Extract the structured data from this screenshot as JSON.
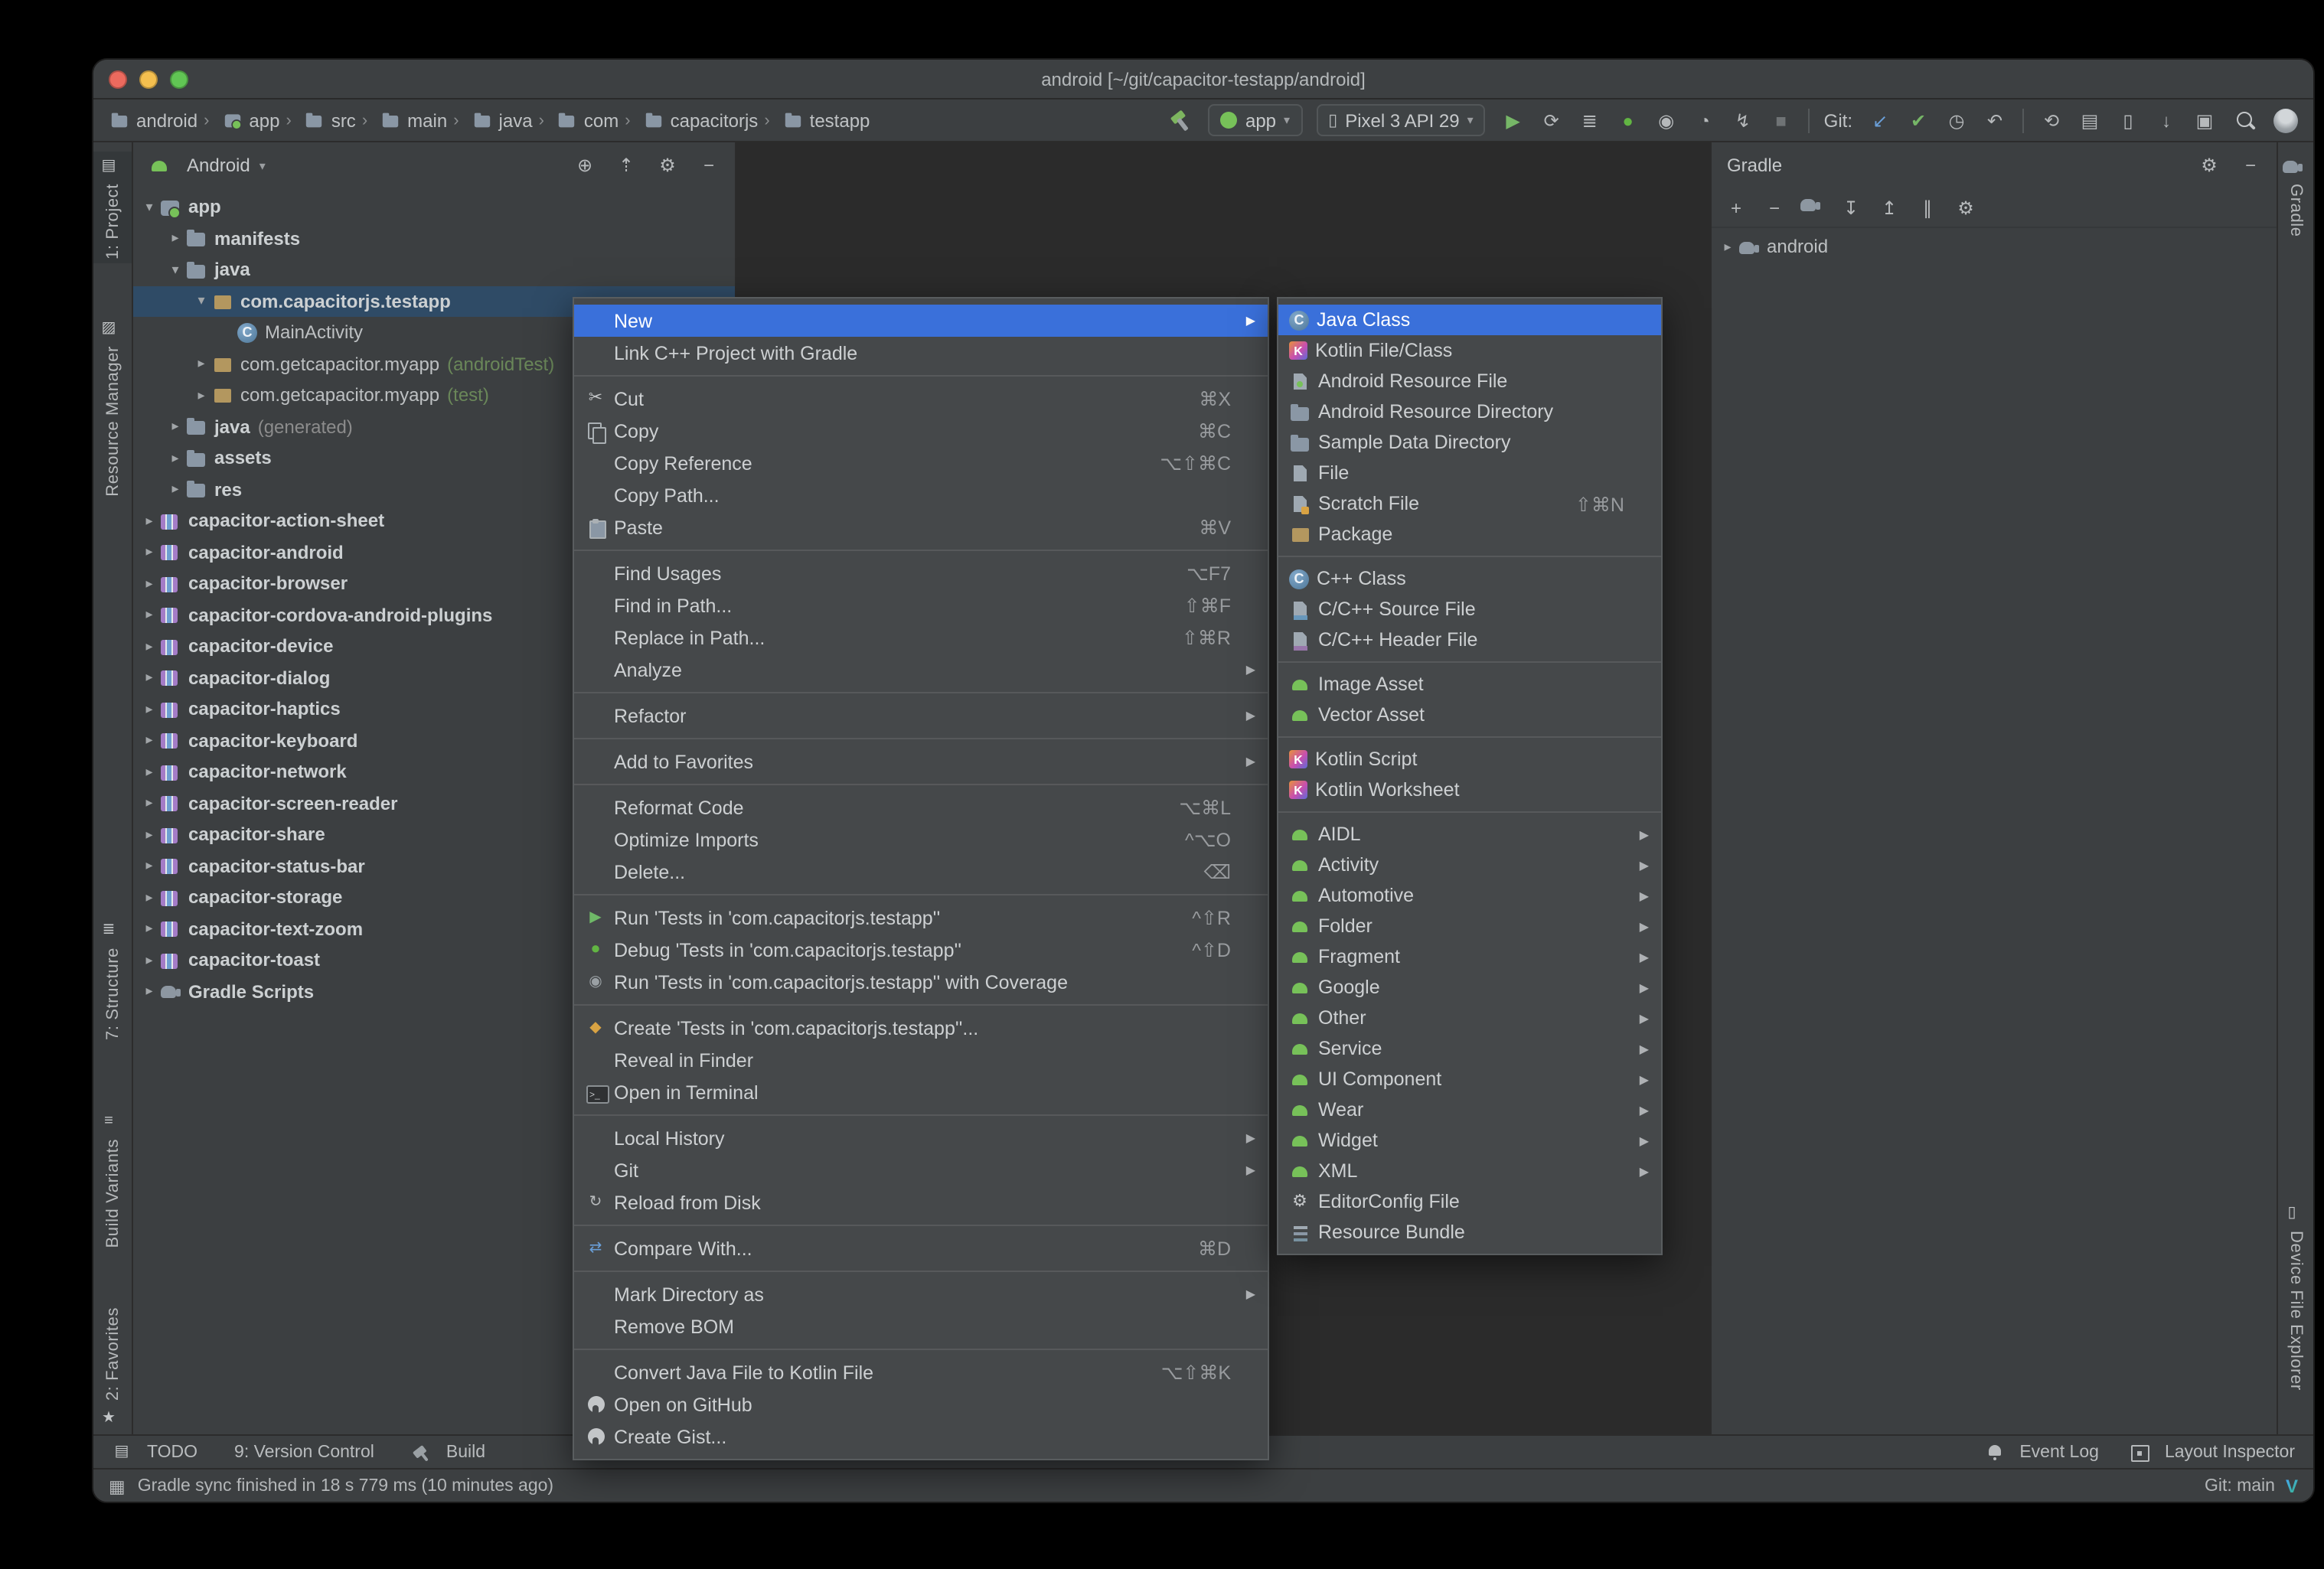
{
  "glyphs": {
    "chevron_down": "▾",
    "crumb_separator": "›",
    "submenu_arrow": "▶",
    "expand_open": "▾",
    "expand_closed": "▸",
    "toolwindows": "▦",
    "v_logo": "V"
  },
  "window": {
    "title": "android [~/git/capacitor-testapp/android]"
  },
  "breadcrumbs": {
    "items": [
      {
        "label": "android",
        "icon": "folder"
      },
      {
        "label": "app",
        "icon": "module-app"
      },
      {
        "label": "src",
        "icon": "folder"
      },
      {
        "label": "main",
        "icon": "folder"
      },
      {
        "label": "java",
        "icon": "folder"
      },
      {
        "label": "com",
        "icon": "folder"
      },
      {
        "label": "capacitorjs",
        "icon": "folder"
      },
      {
        "label": "testapp",
        "icon": "folder"
      }
    ]
  },
  "toolbar": {
    "run_config": "app",
    "device": "Pixel 3 API 29",
    "git_label": "Git:",
    "run_icons": [
      {
        "name": "run-button",
        "glyph": "▶",
        "color": "#76b667"
      },
      {
        "name": "apply-changes-button",
        "glyph": "⟳",
        "color": "#b6b9bb"
      },
      {
        "name": "run-tasks-button",
        "glyph": "≣",
        "color": "#b6b9bb"
      },
      {
        "name": "debug-button",
        "glyph": "●",
        "color": "#62b543"
      },
      {
        "name": "coverage-button",
        "glyph": "◉",
        "color": "#b6b9bb"
      },
      {
        "name": "profiler-button",
        "glyph": "◔",
        "color": "#b6b9bb"
      },
      {
        "name": "attach-debugger-button",
        "glyph": "↯",
        "color": "#b6b9bb"
      },
      {
        "name": "stop-button",
        "glyph": "■",
        "color": "#6f7375"
      }
    ],
    "git_icons": [
      {
        "name": "update-project-button",
        "glyph": "↙",
        "color": "#6a9fd8"
      },
      {
        "name": "commit-button",
        "glyph": "✔",
        "color": "#76b667"
      },
      {
        "name": "history-button",
        "glyph": "◷",
        "color": "#b6b9bb"
      },
      {
        "name": "rollback-button",
        "glyph": "↶",
        "color": "#b6b9bb"
      }
    ],
    "misc_icons": [
      {
        "name": "sync-gradle-button",
        "glyph": "⟲",
        "color": "#b6b9bb"
      },
      {
        "name": "device-manager-button",
        "glyph": "▤",
        "color": "#b6b9bb"
      },
      {
        "name": "avd-manager-button",
        "glyph": "▯",
        "color": "#b6b9bb"
      },
      {
        "name": "sdk-manager-button",
        "glyph": "↓",
        "color": "#b6b9bb"
      },
      {
        "name": "layout-inspector-button",
        "glyph": "▣",
        "color": "#b6b9bb"
      }
    ]
  },
  "left_stripe": {
    "items": [
      {
        "name": "tool-tab-project",
        "label": "1: Project",
        "glyph": "▤",
        "cls": "lp-project active"
      },
      {
        "name": "tool-tab-resource-manager",
        "label": "Resource Manager",
        "glyph": "▨",
        "cls": "lp-resource"
      },
      {
        "name": "tool-tab-structure",
        "label": "7: Structure",
        "glyph": "≣",
        "cls": "lp-structure"
      },
      {
        "name": "tool-tab-build-variants",
        "label": "Build Variants",
        "glyph": "≡",
        "cls": "lp-build"
      },
      {
        "name": "tool-tab-favorites",
        "label": "2: Favorites",
        "glyph": "★",
        "cls": "lp-favorites icon-after"
      }
    ]
  },
  "right_stripe": {
    "items": [
      {
        "name": "tool-tab-gradle",
        "label": "Gradle",
        "icon": "gradle",
        "cls": "rp-gradle"
      },
      {
        "name": "tool-tab-device-file-explorer",
        "label": "Device File Explorer",
        "glyph": "▯",
        "cls": "rp-dfe"
      }
    ]
  },
  "project": {
    "mode": "Android",
    "header_icons": [
      {
        "name": "locate-file-button",
        "glyph": "⊕"
      },
      {
        "name": "collapse-all-button",
        "glyph": "⇡"
      },
      {
        "name": "view-settings-button",
        "glyph": "⚙"
      },
      {
        "name": "hide-panel-button",
        "glyph": "−"
      }
    ],
    "items": [
      {
        "label": "app",
        "indent": 0,
        "expand": "open",
        "icon": "module-app",
        "bold": true
      },
      {
        "label": "manifests",
        "indent": 1,
        "expand": "closed",
        "icon": "folder",
        "bold": true
      },
      {
        "label": "java",
        "indent": 1,
        "expand": "open",
        "icon": "folder",
        "bold": true
      },
      {
        "label": "com.capacitorjs.testapp",
        "indent": 2,
        "expand": "open",
        "icon": "package",
        "bold": true,
        "selected": true
      },
      {
        "label": "MainActivity",
        "indent": 3,
        "icon": "class",
        "glyph": "C"
      },
      {
        "label": "com.getcapacitor.myapp",
        "suffix": "(androidTest)",
        "suffix_color": "#6a8759",
        "indent": 2,
        "expand": "closed",
        "icon": "package"
      },
      {
        "label": "com.getcapacitor.myapp",
        "suffix": "(test)",
        "suffix_color": "#6a8759",
        "indent": 2,
        "expand": "closed",
        "icon": "package"
      },
      {
        "label": "java",
        "suffix": "(generated)",
        "suffix_color": "#8c8c8c",
        "indent": 1,
        "expand": "closed",
        "icon": "folder",
        "bold": true
      },
      {
        "label": "assets",
        "indent": 1,
        "expand": "closed",
        "icon": "folder",
        "bold": true
      },
      {
        "label": "res",
        "indent": 1,
        "expand": "closed",
        "icon": "folder",
        "bold": true
      },
      {
        "label": "capacitor-action-sheet",
        "indent": 0,
        "expand": "closed",
        "icon": "module",
        "bold": true
      },
      {
        "label": "capacitor-android",
        "indent": 0,
        "expand": "closed",
        "icon": "module",
        "bold": true
      },
      {
        "label": "capacitor-browser",
        "indent": 0,
        "expand": "closed",
        "icon": "module",
        "bold": true
      },
      {
        "label": "capacitor-cordova-android-plugins",
        "indent": 0,
        "expand": "closed",
        "icon": "module",
        "bold": true
      },
      {
        "label": "capacitor-device",
        "indent": 0,
        "expand": "closed",
        "icon": "module",
        "bold": true
      },
      {
        "label": "capacitor-dialog",
        "indent": 0,
        "expand": "closed",
        "icon": "module",
        "bold": true
      },
      {
        "label": "capacitor-haptics",
        "indent": 0,
        "expand": "closed",
        "icon": "module",
        "bold": true
      },
      {
        "label": "capacitor-keyboard",
        "indent": 0,
        "expand": "closed",
        "icon": "module",
        "bold": true
      },
      {
        "label": "capacitor-network",
        "indent": 0,
        "expand": "closed",
        "icon": "module",
        "bold": true
      },
      {
        "label": "capacitor-screen-reader",
        "indent": 0,
        "expand": "closed",
        "icon": "module",
        "bold": true
      },
      {
        "label": "capacitor-share",
        "indent": 0,
        "expand": "closed",
        "icon": "module",
        "bold": true
      },
      {
        "label": "capacitor-status-bar",
        "indent": 0,
        "expand": "closed",
        "icon": "module",
        "bold": true
      },
      {
        "label": "capacitor-storage",
        "indent": 0,
        "expand": "closed",
        "icon": "module",
        "bold": true
      },
      {
        "label": "capacitor-text-zoom",
        "indent": 0,
        "expand": "closed",
        "icon": "module",
        "bold": true
      },
      {
        "label": "capacitor-toast",
        "indent": 0,
        "expand": "closed",
        "icon": "module",
        "bold": true
      },
      {
        "label": "Gradle Scripts",
        "indent": 0,
        "expand": "closed",
        "icon": "gradle",
        "bold": true
      }
    ]
  },
  "gradle_panel": {
    "title": "Gradle",
    "header_icons": [
      {
        "name": "gradle-settings-button",
        "glyph": "⚙"
      },
      {
        "name": "hide-panel-button",
        "glyph": "−"
      }
    ],
    "toolbar_icons": [
      {
        "name": "add-gradle-project-button",
        "glyph": "+"
      },
      {
        "name": "remove-gradle-project-button",
        "glyph": "−"
      },
      {
        "name": "sync-all-gradle-projects-button",
        "icon": "gradle"
      },
      {
        "name": "expand-all-button",
        "glyph": "↧"
      },
      {
        "name": "collapse-all-button",
        "glyph": "↥"
      },
      {
        "name": "run-task-button",
        "glyph": "∥"
      },
      {
        "name": "gradle-tools-button",
        "glyph": "⚙"
      }
    ],
    "items": [
      {
        "label": "android",
        "indent": 0,
        "expand": "closed",
        "icon": "gradle"
      }
    ]
  },
  "context_menu": {
    "items": [
      {
        "label": "New",
        "selected": true,
        "arrow": true
      },
      {
        "label": "Link C++ Project with Gradle"
      },
      {
        "sep": true
      },
      {
        "label": "Cut",
        "icon": "cut",
        "glyph": "✂",
        "shortcut": "⌘X"
      },
      {
        "label": "Copy",
        "icon": "copy",
        "shortcut": "⌘C"
      },
      {
        "label": "Copy Reference",
        "shortcut": "⌥⇧⌘C"
      },
      {
        "label": "Copy Path..."
      },
      {
        "label": "Paste",
        "icon": "paste",
        "shortcut": "⌘V"
      },
      {
        "sep": true
      },
      {
        "label": "Find Usages",
        "shortcut": "⌥F7"
      },
      {
        "label": "Find in Path...",
        "shortcut": "⇧⌘F"
      },
      {
        "label": "Replace in Path...",
        "shortcut": "⇧⌘R"
      },
      {
        "label": "Analyze",
        "arrow": true
      },
      {
        "sep": true
      },
      {
        "label": "Refactor",
        "arrow": true
      },
      {
        "sep": true
      },
      {
        "label": "Add to Favorites",
        "arrow": true
      },
      {
        "sep": true
      },
      {
        "label": "Reformat Code",
        "shortcut": "⌥⌘L"
      },
      {
        "label": "Optimize Imports",
        "shortcut": "^⌥O"
      },
      {
        "label": "Delete...",
        "shortcut": "⌫"
      },
      {
        "sep": true
      },
      {
        "label": "Run 'Tests in 'com.capacitorjs.testapp''",
        "icon": "run",
        "glyph": "▶",
        "color": "#6fb968",
        "shortcut": "^⇧R"
      },
      {
        "label": "Debug 'Tests in 'com.capacitorjs.testapp''",
        "icon": "debug",
        "glyph": "●",
        "color": "#62b543",
        "shortcut": "^⇧D"
      },
      {
        "label": "Run 'Tests in 'com.capacitorjs.testapp'' with Coverage",
        "icon": "coverage",
        "glyph": "◉",
        "color": "#9aa0a4"
      },
      {
        "sep": true
      },
      {
        "label": "Create 'Tests in 'com.capacitorjs.testapp''...",
        "icon": "create-tests",
        "glyph": "◆",
        "color": "#d9a343"
      },
      {
        "label": "Reveal in Finder"
      },
      {
        "label": "Open in Terminal",
        "icon": "terminal"
      },
      {
        "sep": true
      },
      {
        "label": "Local History",
        "arrow": true
      },
      {
        "label": "Git",
        "arrow": true
      },
      {
        "label": "Reload from Disk",
        "icon": "reload",
        "glyph": "↻",
        "color": "#b6b9bb"
      },
      {
        "sep": true
      },
      {
        "label": "Compare With...",
        "icon": "compare",
        "glyph": "⇄",
        "color": "#6a9fd8",
        "shortcut": "⌘D"
      },
      {
        "sep": true
      },
      {
        "label": "Mark Directory as",
        "arrow": true
      },
      {
        "label": "Remove BOM"
      },
      {
        "sep": true
      },
      {
        "label": "Convert Java File to Kotlin File",
        "shortcut": "⌥⇧⌘K"
      },
      {
        "label": "Open on GitHub",
        "icon": "github"
      },
      {
        "label": "Create Gist...",
        "icon": "github"
      }
    ]
  },
  "new_submenu": {
    "items": [
      {
        "label": "Java Class",
        "icon": "class",
        "glyph": "C",
        "selected": true
      },
      {
        "label": "Kotlin File/Class",
        "icon": "kotlin",
        "glyph": "K"
      },
      {
        "label": "Android Resource File",
        "icon": "android-file"
      },
      {
        "label": "Android Resource Directory",
        "icon": "folder"
      },
      {
        "label": "Sample Data Directory",
        "icon": "folder"
      },
      {
        "label": "File",
        "icon": "file"
      },
      {
        "label": "Scratch File",
        "icon": "scratch",
        "shortcut": "⇧⌘N"
      },
      {
        "label": "Package",
        "icon": "package"
      },
      {
        "sep": true
      },
      {
        "label": "C++ Class",
        "icon": "cpp-class",
        "glyph": "C"
      },
      {
        "label": "C/C++ Source File",
        "icon": "cpp-file"
      },
      {
        "label": "C/C++ Header File",
        "icon": "cpp-header"
      },
      {
        "sep": true
      },
      {
        "label": "Image Asset",
        "icon": "android"
      },
      {
        "label": "Vector Asset",
        "icon": "android"
      },
      {
        "sep": true
      },
      {
        "label": "Kotlin Script",
        "icon": "kotlin",
        "glyph": "K"
      },
      {
        "label": "Kotlin Worksheet",
        "icon": "kotlin",
        "glyph": "K"
      },
      {
        "sep": true
      },
      {
        "label": "AIDL",
        "icon": "android",
        "arrow": true
      },
      {
        "label": "Activity",
        "icon": "android",
        "arrow": true
      },
      {
        "label": "Automotive",
        "icon": "android",
        "arrow": true
      },
      {
        "label": "Folder",
        "icon": "android",
        "arrow": true
      },
      {
        "label": "Fragment",
        "icon": "android",
        "arrow": true
      },
      {
        "label": "Google",
        "icon": "android",
        "arrow": true
      },
      {
        "label": "Other",
        "icon": "android",
        "arrow": true
      },
      {
        "label": "Service",
        "icon": "android",
        "arrow": true
      },
      {
        "label": "UI Component",
        "icon": "android",
        "arrow": true
      },
      {
        "label": "Wear",
        "icon": "android",
        "arrow": true
      },
      {
        "label": "Widget",
        "icon": "android",
        "arrow": true
      },
      {
        "label": "XML",
        "icon": "android",
        "arrow": true
      },
      {
        "label": "EditorConfig File",
        "icon": "editorconfig",
        "glyph": "⚙"
      },
      {
        "label": "Resource Bundle",
        "icon": "bundle"
      }
    ]
  },
  "bottom_bar": {
    "left": [
      {
        "name": "tool-tab-todo",
        "label": "TODO",
        "glyph": "▤"
      },
      {
        "name": "tool-tab-version-control",
        "label": "9: Version Control"
      },
      {
        "name": "tool-tab-build",
        "label": "Build",
        "icon": "hammer"
      }
    ],
    "right": [
      {
        "name": "event-log-button",
        "label": "Event Log",
        "icon": "bell"
      },
      {
        "name": "layout-inspector-button",
        "label": "Layout Inspector",
        "icon": "inspector"
      }
    ]
  },
  "statusbar": {
    "message": "Gradle sync finished in 18 s 779 ms (10 minutes ago)",
    "git_branch": "Git: main"
  }
}
